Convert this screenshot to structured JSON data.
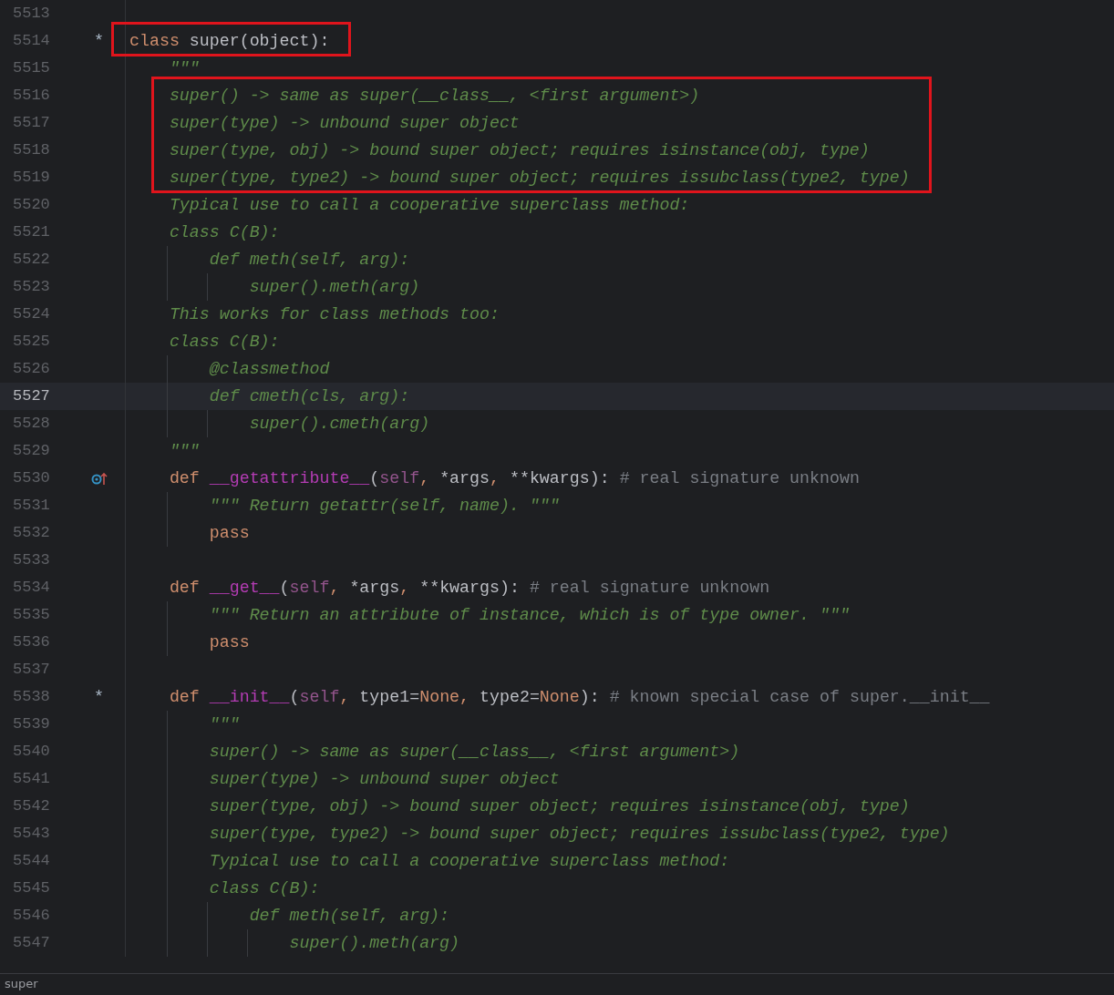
{
  "lines": [
    {
      "number": "5513",
      "current": false,
      "overrides": false,
      "boxed": false
    },
    {
      "number": "5514",
      "marker": "*",
      "current": false,
      "overrides": false,
      "boxed": true,
      "tokens": [
        {
          "kind": "kw",
          "text": "class "
        },
        {
          "kind": "plain",
          "text": "super(object):"
        }
      ]
    },
    {
      "number": "5515",
      "current": false,
      "overrides": false,
      "boxed": false,
      "tokens": [
        {
          "kind": "doc",
          "text": "    \"\"\""
        }
      ]
    },
    {
      "number": "5516",
      "current": false,
      "overrides": false,
      "boxed": true,
      "tokens": [
        {
          "kind": "doc",
          "text": "    super() -> same as super(__class__, <first argument>)"
        }
      ]
    },
    {
      "number": "5517",
      "current": false,
      "overrides": false,
      "boxed": true,
      "tokens": [
        {
          "kind": "doc",
          "text": "    super(type) -> unbound super object"
        }
      ]
    },
    {
      "number": "5518",
      "current": false,
      "overrides": false,
      "boxed": true,
      "tokens": [
        {
          "kind": "doc",
          "text": "    super(type, obj) -> bound super object; requires isinstance(obj, type)"
        }
      ]
    },
    {
      "number": "5519",
      "current": false,
      "overrides": false,
      "boxed": true,
      "tokens": [
        {
          "kind": "doc",
          "text": "    super(type, type2) -> bound super object; requires issubclass(type2, type)"
        }
      ]
    },
    {
      "number": "5520",
      "current": false,
      "overrides": false,
      "boxed": false,
      "tokens": [
        {
          "kind": "doc",
          "text": "    Typical use to call a cooperative superclass method:"
        }
      ]
    },
    {
      "number": "5521",
      "current": false,
      "overrides": false,
      "boxed": false,
      "tokens": [
        {
          "kind": "doc",
          "text": "    class C(B):"
        }
      ]
    },
    {
      "number": "5522",
      "current": false,
      "overrides": false,
      "boxed": false,
      "tokens": [
        {
          "kind": "doc",
          "text": "        def meth(self, arg):"
        }
      ]
    },
    {
      "number": "5523",
      "current": false,
      "overrides": false,
      "boxed": false,
      "tokens": [
        {
          "kind": "doc",
          "text": "            super().meth(arg)"
        }
      ]
    },
    {
      "number": "5524",
      "current": false,
      "overrides": false,
      "boxed": false,
      "tokens": [
        {
          "kind": "doc",
          "text": "    This works for class methods too:"
        }
      ]
    },
    {
      "number": "5525",
      "current": false,
      "overrides": false,
      "boxed": false,
      "tokens": [
        {
          "kind": "doc",
          "text": "    class C(B):"
        }
      ]
    },
    {
      "number": "5526",
      "current": false,
      "overrides": false,
      "boxed": false,
      "tokens": [
        {
          "kind": "doc",
          "text": "        @classmethod"
        }
      ]
    },
    {
      "number": "5527",
      "current": true,
      "overrides": false,
      "boxed": false,
      "tokens": [
        {
          "kind": "doc",
          "text": "        def cmeth(cls, arg):"
        }
      ]
    },
    {
      "number": "5528",
      "current": false,
      "overrides": false,
      "boxed": false,
      "tokens": [
        {
          "kind": "doc",
          "text": "            super().cmeth(arg)"
        }
      ]
    },
    {
      "number": "5529",
      "current": false,
      "overrides": false,
      "boxed": false,
      "tokens": [
        {
          "kind": "doc",
          "text": "    \"\"\""
        }
      ]
    },
    {
      "number": "5530",
      "current": false,
      "overrides": true,
      "boxed": false,
      "tokens": [
        {
          "kind": "kw",
          "text": "    def "
        },
        {
          "kind": "dunder",
          "text": "__getattribute__"
        },
        {
          "kind": "plain",
          "text": "("
        },
        {
          "kind": "self",
          "text": "self"
        },
        {
          "kind": "punct",
          "text": ","
        },
        {
          "kind": "plain",
          "text": " *args"
        },
        {
          "kind": "punct",
          "text": ","
        },
        {
          "kind": "plain",
          "text": " **kwargs): "
        },
        {
          "kind": "comment",
          "text": "# real signature unknown"
        }
      ]
    },
    {
      "number": "5531",
      "current": false,
      "overrides": false,
      "boxed": false,
      "tokens": [
        {
          "kind": "doc",
          "text": "        \"\"\" Return getattr(self, name). \"\"\""
        }
      ]
    },
    {
      "number": "5532",
      "current": false,
      "overrides": false,
      "boxed": false,
      "tokens": [
        {
          "kind": "kw",
          "text": "        pass"
        }
      ]
    },
    {
      "number": "5533",
      "current": false,
      "overrides": false,
      "boxed": false
    },
    {
      "number": "5534",
      "current": false,
      "overrides": false,
      "boxed": false,
      "tokens": [
        {
          "kind": "kw",
          "text": "    def "
        },
        {
          "kind": "dunder",
          "text": "__get__"
        },
        {
          "kind": "plain",
          "text": "("
        },
        {
          "kind": "self",
          "text": "self"
        },
        {
          "kind": "punct",
          "text": ","
        },
        {
          "kind": "plain",
          "text": " *args"
        },
        {
          "kind": "punct",
          "text": ","
        },
        {
          "kind": "plain",
          "text": " **kwargs): "
        },
        {
          "kind": "comment",
          "text": "# real signature unknown"
        }
      ]
    },
    {
      "number": "5535",
      "current": false,
      "overrides": false,
      "boxed": false,
      "tokens": [
        {
          "kind": "doc",
          "text": "        \"\"\" Return an attribute of instance, which is of type owner. \"\"\""
        }
      ]
    },
    {
      "number": "5536",
      "current": false,
      "overrides": false,
      "boxed": false,
      "tokens": [
        {
          "kind": "kw",
          "text": "        pass"
        }
      ]
    },
    {
      "number": "5537",
      "current": false,
      "overrides": false,
      "boxed": false
    },
    {
      "number": "5538",
      "marker": "*",
      "current": false,
      "overrides": false,
      "boxed": false,
      "tokens": [
        {
          "kind": "kw",
          "text": "    def "
        },
        {
          "kind": "dunder",
          "text": "__init__"
        },
        {
          "kind": "plain",
          "text": "("
        },
        {
          "kind": "self",
          "text": "self"
        },
        {
          "kind": "punct",
          "text": ","
        },
        {
          "kind": "plain",
          "text": " type1="
        },
        {
          "kind": "kw",
          "text": "None"
        },
        {
          "kind": "punct",
          "text": ","
        },
        {
          "kind": "plain",
          "text": " type2="
        },
        {
          "kind": "kw",
          "text": "None"
        },
        {
          "kind": "plain",
          "text": "): "
        },
        {
          "kind": "comment",
          "text": "# known special case of super.__init__"
        }
      ]
    },
    {
      "number": "5539",
      "current": false,
      "overrides": false,
      "boxed": false,
      "tokens": [
        {
          "kind": "doc",
          "text": "        \"\"\""
        }
      ]
    },
    {
      "number": "5540",
      "current": false,
      "overrides": false,
      "boxed": false,
      "tokens": [
        {
          "kind": "doc",
          "text": "        super() -> same as super(__class__, <first argument>)"
        }
      ]
    },
    {
      "number": "5541",
      "current": false,
      "overrides": false,
      "boxed": false,
      "tokens": [
        {
          "kind": "doc",
          "text": "        super(type) -> unbound super object"
        }
      ]
    },
    {
      "number": "5542",
      "current": false,
      "overrides": false,
      "boxed": false,
      "tokens": [
        {
          "kind": "doc",
          "text": "        super(type, obj) -> bound super object; requires isinstance(obj, type)"
        }
      ]
    },
    {
      "number": "5543",
      "current": false,
      "overrides": false,
      "boxed": false,
      "tokens": [
        {
          "kind": "doc",
          "text": "        super(type, type2) -> bound super object; requires issubclass(type2, type)"
        }
      ]
    },
    {
      "number": "5544",
      "current": false,
      "overrides": false,
      "boxed": false,
      "tokens": [
        {
          "kind": "doc",
          "text": "        Typical use to call a cooperative superclass method:"
        }
      ]
    },
    {
      "number": "5545",
      "current": false,
      "overrides": false,
      "boxed": false,
      "tokens": [
        {
          "kind": "doc",
          "text": "        class C(B):"
        }
      ]
    },
    {
      "number": "5546",
      "current": false,
      "overrides": false,
      "boxed": false,
      "tokens": [
        {
          "kind": "doc",
          "text": "            def meth(self, arg):"
        }
      ]
    },
    {
      "number": "5547",
      "current": false,
      "overrides": false,
      "boxed": false,
      "tokens": [
        {
          "kind": "doc",
          "text": "                super().meth(arg)"
        }
      ]
    }
  ],
  "status_bar": {
    "text": "super"
  }
}
